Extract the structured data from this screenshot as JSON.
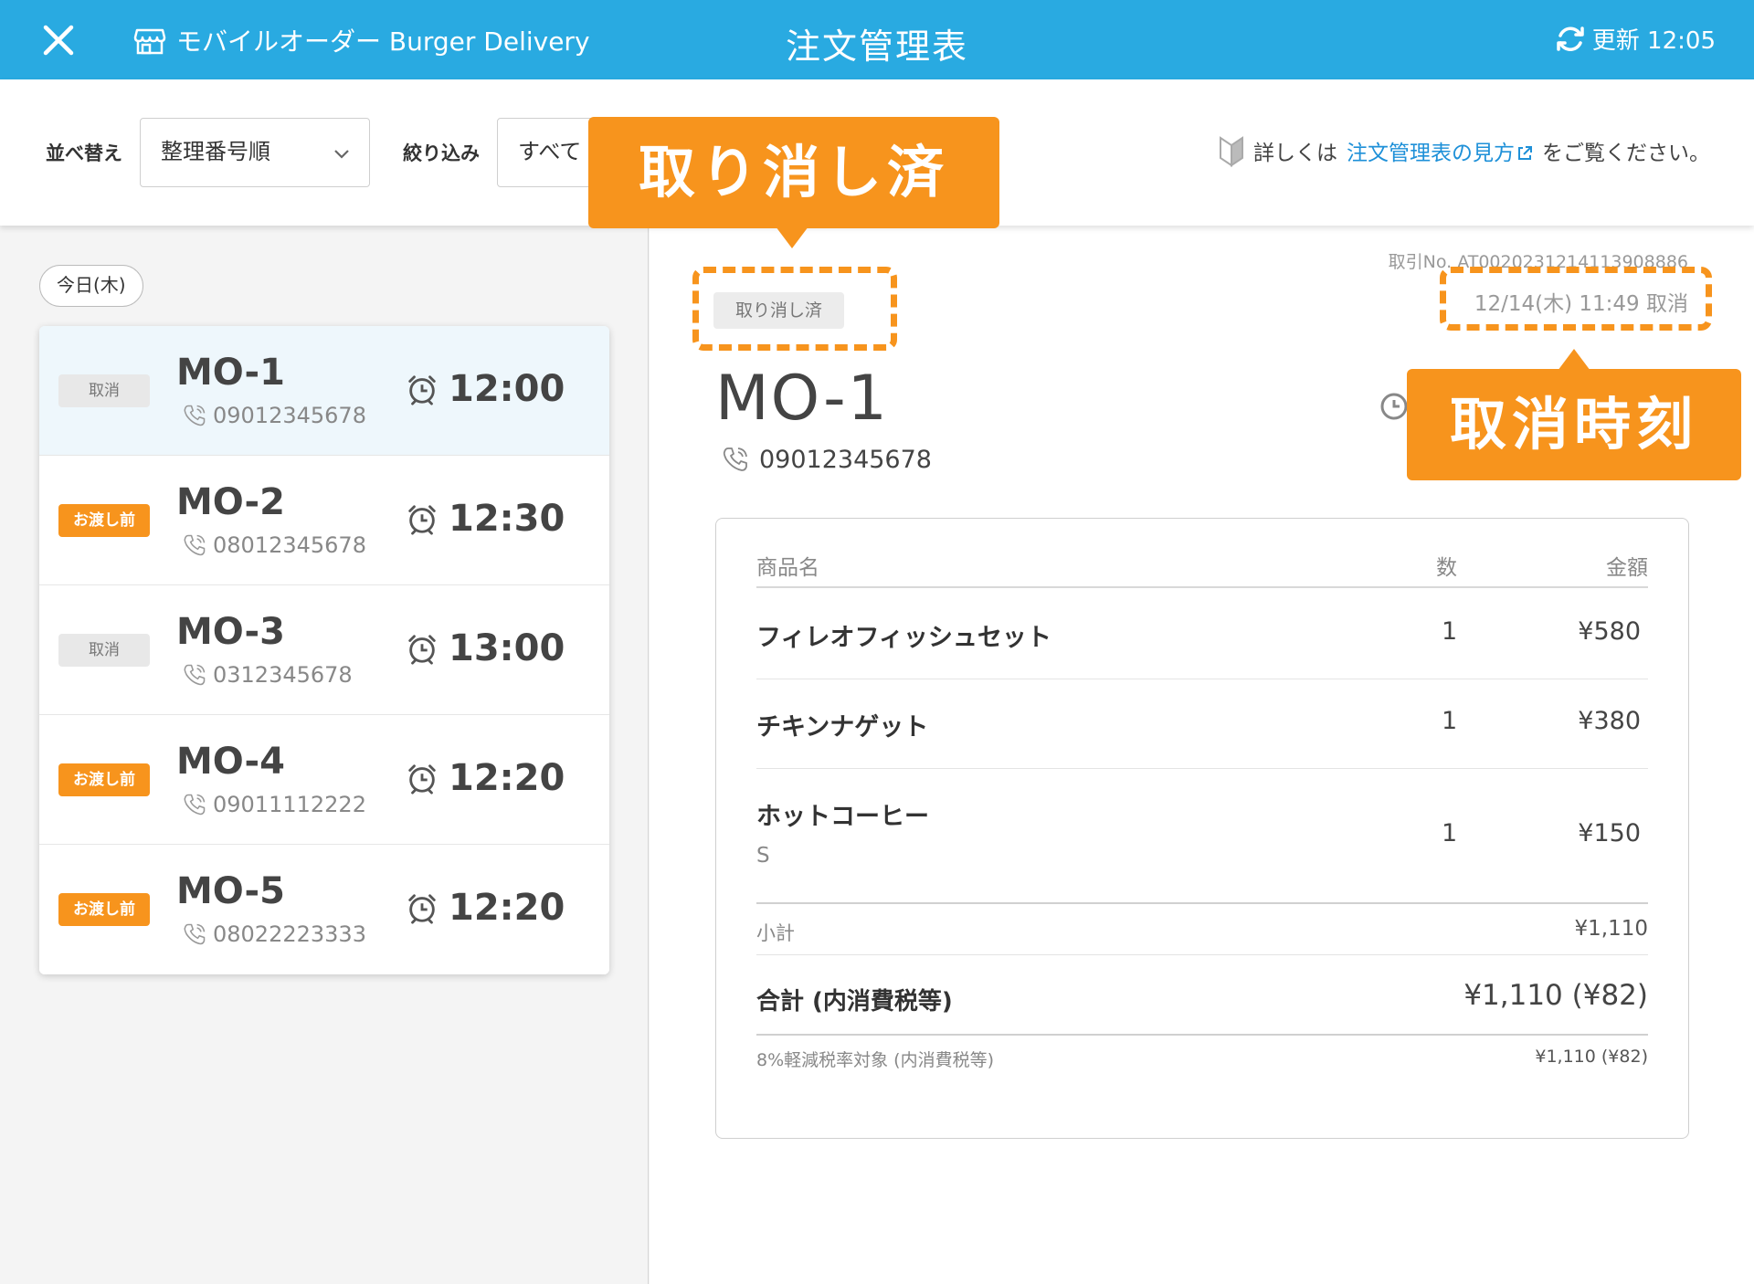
{
  "header": {
    "store_name": "モバイルオーダー Burger Delivery",
    "title": "注文管理表",
    "refresh_label": "更新 12:05"
  },
  "toolbar": {
    "sort_label": "並べ替え",
    "sort_value": "整理番号順",
    "filter_label": "絞り込み",
    "filter_value": "すべて",
    "help_prefix": "詳しくは",
    "help_link": "注文管理表の見方",
    "help_suffix": "をご覧ください。"
  },
  "list": {
    "day_chip": "今日(木)",
    "orders": [
      {
        "status": "取消",
        "status_color": "gray",
        "id": "MO-1",
        "phone": "09012345678",
        "time": "12:00"
      },
      {
        "status": "お渡し前",
        "status_color": "orange",
        "id": "MO-2",
        "phone": "08012345678",
        "time": "12:30"
      },
      {
        "status": "取消",
        "status_color": "gray",
        "id": "MO-3",
        "phone": "0312345678",
        "time": "13:00"
      },
      {
        "status": "お渡し前",
        "status_color": "orange",
        "id": "MO-4",
        "phone": "09011112222",
        "time": "12:20"
      },
      {
        "status": "お渡し前",
        "status_color": "orange",
        "id": "MO-5",
        "phone": "08022223333",
        "time": "12:20"
      }
    ]
  },
  "detail": {
    "status": "取り消し済",
    "transaction_no": "取引No. AT00202312141139088​86",
    "cancel_time": "12/14(木)  11:49  取消",
    "order_id": "MO-1",
    "phone": "09012345678",
    "table": {
      "col_name": "商品名",
      "col_qty": "数",
      "col_amount": "金額",
      "items": [
        {
          "name": "フィレオフィッシュセット",
          "option": "",
          "qty": "1",
          "amount": "¥580"
        },
        {
          "name": "チキンナゲット",
          "option": "",
          "qty": "1",
          "amount": "¥380"
        },
        {
          "name": "ホットコーヒー",
          "option": "S",
          "qty": "1",
          "amount": "¥150"
        }
      ],
      "subtotal_label": "小計",
      "subtotal_value": "¥1,110",
      "total_label": "合計 (内消費税等)",
      "total_value": "¥1,110 (¥82)",
      "tax_label": "8%軽減税率対象 (内消費税等)",
      "tax_value": "¥1,110 (¥82)"
    }
  },
  "annotations": {
    "callout_status": "取り消し済",
    "callout_time": "取消時刻"
  },
  "colors": {
    "header_bg": "#29aae1",
    "accent_orange": "#f7941d",
    "link_blue": "#1e90d8"
  }
}
